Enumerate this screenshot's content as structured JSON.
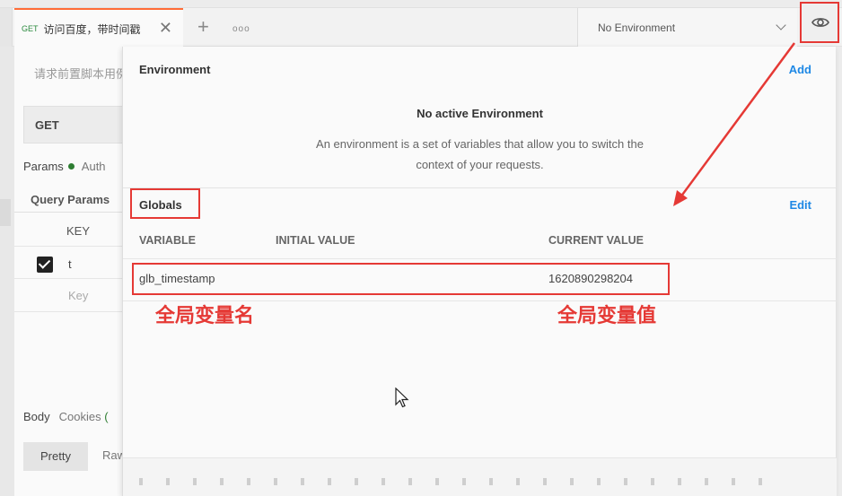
{
  "tab": {
    "method": "GET",
    "name": "访问百度，带时间戳",
    "close": "✕"
  },
  "tabbar": {
    "new_tab": "+",
    "more": "ooo"
  },
  "environment_selector": {
    "selected": "No Environment"
  },
  "eye_icon": "eye-icon",
  "request": {
    "placeholder": "请求前置脚本用例",
    "method": "GET",
    "tabs": {
      "params": "Params",
      "auth": "Auth"
    },
    "query_params_label": "Query Params",
    "key_header": "KEY",
    "rows": [
      {
        "key": "t",
        "checked": true
      }
    ],
    "key_placeholder": "Key"
  },
  "response": {
    "tabs": {
      "body": "Body",
      "cookies": "Cookies",
      "cookies_suffix": "("
    },
    "pretty": "Pretty",
    "raw": "Raw"
  },
  "popover": {
    "environment_title": "Environment",
    "add": "Add",
    "no_active_title": "No active Environment",
    "no_active_desc": "An environment is a set of variables that allow you to switch the context of your requests.",
    "globals_title": "Globals",
    "edit": "Edit",
    "columns": {
      "variable": "VARIABLE",
      "initial": "INITIAL VALUE",
      "current": "CURRENT VALUE"
    },
    "globals": [
      {
        "variable": "glb_timestamp",
        "initial": "",
        "current": "1620890298204"
      }
    ]
  },
  "annotations": {
    "name_label": "全局变量名",
    "value_label": "全局变量值"
  },
  "colors": {
    "accent": "#ff6c37",
    "link": "#1e88e5",
    "highlight": "#e53935",
    "success": "#2e7d32"
  }
}
